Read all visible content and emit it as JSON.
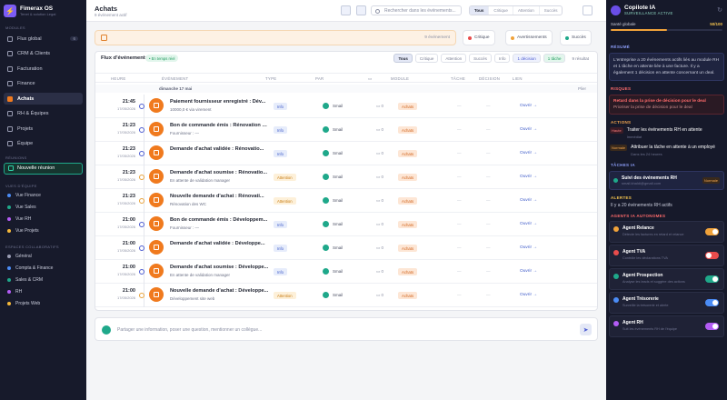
{
  "app": {
    "name": "Fimerax OS",
    "subtitle": "Tenet & solution Legal"
  },
  "sidebar": {
    "modules_title": "MODULES",
    "items": [
      {
        "label": "Flux global",
        "count": "6",
        "active": false
      },
      {
        "label": "CRM & Clients",
        "count": "",
        "active": false
      },
      {
        "label": "Facturation",
        "count": "",
        "active": false
      },
      {
        "label": "Finance",
        "count": "",
        "active": false
      },
      {
        "label": "Achats",
        "count": "",
        "active": true
      },
      {
        "label": "RH & Équipes",
        "count": "",
        "active": false
      },
      {
        "label": "Projets",
        "count": "",
        "active": false
      },
      {
        "label": "Équipe",
        "count": "",
        "active": false
      }
    ],
    "meetings_title": "RÉUNIONS",
    "new_meeting": "Nouvelle réunion",
    "team_title": "VUES D'ÉQUIPE",
    "teams": [
      {
        "label": "Vue Finance",
        "color": "#4b8cf5"
      },
      {
        "label": "Vue Sales",
        "color": "#1fa88a"
      },
      {
        "label": "Vue RH",
        "color": "#b35cf5"
      },
      {
        "label": "Vue Projets",
        "color": "#f5b83a"
      }
    ],
    "collab_title": "ESPACES COLLABORATIFS",
    "spaces": [
      {
        "label": "Général",
        "color": "#9a9db3"
      },
      {
        "label": "Compta & Finance",
        "color": "#4b8cf5"
      },
      {
        "label": "Sales & CRM",
        "color": "#1fa88a"
      },
      {
        "label": "RH",
        "color": "#b35cf5"
      },
      {
        "label": "Projets Web",
        "color": "#f5b83a"
      }
    ]
  },
  "header": {
    "title": "Achats",
    "subtitle": "9 événement actif",
    "search_placeholder": "Rechercher dans les événements...",
    "filters": [
      "Tous",
      "Critique",
      "Attention",
      "Succès"
    ]
  },
  "summary": {
    "events": "9 événement",
    "critical": "Critique",
    "warnings": "Avertissements",
    "success": "Succès"
  },
  "flux": {
    "title": "Flux d'événements",
    "live": "• En temps réel",
    "chips": [
      "Tous",
      "Critique",
      "Attention",
      "Succès",
      "Info",
      "1 décision",
      "1 tâche",
      "9 résultat"
    ],
    "columns": {
      "heure": "HEURE",
      "evenement": "ÉVÉNEMENT",
      "type": "TYPE",
      "par": "PAR",
      "module": "MODULE",
      "tache": "TÂCHE",
      "decision": "DÉCISION",
      "lien": "LIEN"
    },
    "day": {
      "label": "dimanche 17 mai",
      "toggle": "Plier"
    },
    "rows": [
      {
        "time": "21:45",
        "date": "17/05/2026",
        "title": "Paiement fournisseur enregistré : Dév...",
        "sub": "10000,0 € via virement",
        "type": "Info",
        "by": "Smail",
        "comments": "0",
        "module": "Achats",
        "task": "—",
        "decision": "—",
        "link": "Ouvrir →"
      },
      {
        "time": "21:23",
        "date": "17/05/2026",
        "title": "Bon de commande émis : Rénovation d...",
        "sub": "Fournisseur : —",
        "type": "Info",
        "by": "Smail",
        "comments": "0",
        "module": "Achats",
        "task": "—",
        "decision": "—",
        "link": "Ouvrir →"
      },
      {
        "time": "21:23",
        "date": "17/05/2026",
        "title": "Demande d'achat validée : Rénovatio...",
        "sub": "",
        "type": "Info",
        "by": "Smail",
        "comments": "0",
        "module": "Achats",
        "task": "—",
        "decision": "—",
        "link": "Ouvrir →"
      },
      {
        "time": "21:23",
        "date": "17/05/2026",
        "title": "Demande d'achat soumise : Rénovatio...",
        "sub": "En attente de validation manager",
        "type": "Attention",
        "by": "Smail",
        "comments": "0",
        "module": "Achats",
        "task": "—",
        "decision": "—",
        "link": "Ouvrir →"
      },
      {
        "time": "21:23",
        "date": "17/05/2026",
        "title": "Nouvelle demande d'achat : Rénovati...",
        "sub": "Rénovation des WC",
        "type": "Attention",
        "by": "Smail",
        "comments": "0",
        "module": "Achats",
        "task": "—",
        "decision": "—",
        "link": "Ouvrir →"
      },
      {
        "time": "21:00",
        "date": "17/05/2026",
        "title": "Bon de commande émis : Développem...",
        "sub": "Fournisseur : —",
        "type": "Info",
        "by": "Smail",
        "comments": "0",
        "module": "Achats",
        "task": "—",
        "decision": "—",
        "link": "Ouvrir →"
      },
      {
        "time": "21:00",
        "date": "17/05/2026",
        "title": "Demande d'achat validée : Développe...",
        "sub": "",
        "type": "Info",
        "by": "Smail",
        "comments": "0",
        "module": "Achats",
        "task": "—",
        "decision": "—",
        "link": "Ouvrir →"
      },
      {
        "time": "21:00",
        "date": "17/05/2026",
        "title": "Demande d'achat soumise : Développe...",
        "sub": "En attente de validation manager",
        "type": "Info",
        "by": "Smail",
        "comments": "0",
        "module": "Achats",
        "task": "—",
        "decision": "—",
        "link": "Ouvrir →"
      },
      {
        "time": "21:00",
        "date": "17/05/2026",
        "title": "Nouvelle demande d'achat : Développe...",
        "sub": "Développement site web",
        "type": "Attention",
        "by": "Smail",
        "comments": "0",
        "module": "Achats",
        "task": "—",
        "decision": "—",
        "link": "Ouvrir →"
      }
    ]
  },
  "composer": {
    "placeholder": "Partager une information, poser une question, mentionner un collègue..."
  },
  "copilot": {
    "title": "Copilote IA",
    "status": "SURVEILLANCE ACTIVE",
    "health_label": "Santé globale",
    "health_value": "50/100",
    "health_pct": 50,
    "summary_title": "RÉSUMÉ",
    "summary": "L'entreprise a 20 événements actifs liés au module RH et 1 tâche en attente liée à une facture. Il y a également 1 décision en attente concernant un deal.",
    "risks_title": "RISQUES",
    "risk_title": "Retard dans la prise de décision pour le deal",
    "risk_sub": "Prioriser la prise de décision pour le deal",
    "actions_title": "ACTIONS",
    "actions": [
      {
        "tag": "Haute",
        "text": "Traiter les événements RH en attente",
        "sub": "Immédiat"
      },
      {
        "tag": "Normale",
        "text": "Attribuer la tâche en attente à un employé",
        "sub": "Dans les 24 heures"
      }
    ],
    "tasks_title": "TÂCHES IA",
    "task_title": "Suivi des événements RH",
    "task_sub": "smail.khaldi@gmail.com",
    "task_badge": "Normale",
    "alerts_title": "ALERTES",
    "alert": "Il y a 20 événements RH actifs",
    "agents_title": "AGENTS IA AUTONOMES",
    "agents": [
      {
        "name": "Agent Relance",
        "desc": "Détecte les factures en retard et relance",
        "on": true,
        "color": "#f0a23a"
      },
      {
        "name": "Agent TVA",
        "desc": "Contrôle les déclarations TVA",
        "on": false,
        "color": "#e84c4c"
      },
      {
        "name": "Agent Prospection",
        "desc": "Analyse les leads et suggère des actions",
        "on": true,
        "color": "#1fa88a"
      },
      {
        "name": "Agent Trésorerie",
        "desc": "Surveille la trésorerie et alerte",
        "on": true,
        "color": "#4b8cf5"
      },
      {
        "name": "Agent RH",
        "desc": "Suit les événements RH de l'équipe",
        "on": true,
        "color": "#b35cf5"
      }
    ]
  },
  "colors": {
    "accent": "#f07a1e",
    "brand": "#7c5cf5",
    "sidebar_bg": "#171a2b",
    "copilot_bg": "#16192a"
  }
}
